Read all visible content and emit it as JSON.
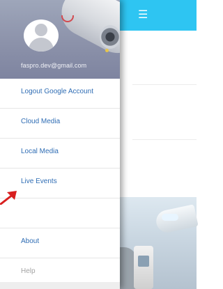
{
  "app": {
    "menu_icon": "hamburger-icon"
  },
  "drawer": {
    "user_email": "faspro.dev@gmail.com",
    "avatar_icon": "user-avatar-icon",
    "menu": [
      {
        "label": "Logout Google Account"
      },
      {
        "label": "Cloud Media"
      },
      {
        "label": "Local Media"
      },
      {
        "label": "Live Events"
      },
      {
        "label": ""
      },
      {
        "label": "About"
      },
      {
        "label": "Help"
      }
    ]
  },
  "annotation": {
    "icon": "red-arrow-icon",
    "color": "#d81f1f"
  },
  "colors": {
    "accent": "#2ec5f2",
    "link": "#2f6db4",
    "muted": "#a3a3a3"
  }
}
